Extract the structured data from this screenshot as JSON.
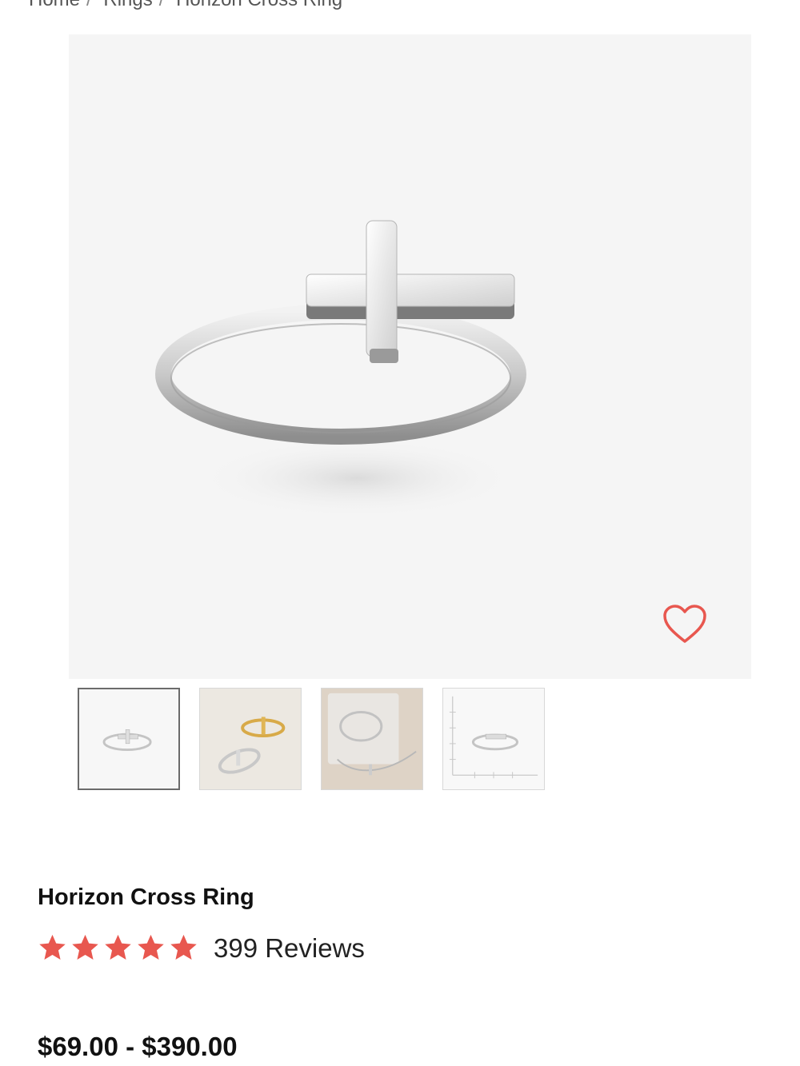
{
  "breadcrumb": {
    "items": [
      "Home",
      "Rings",
      "Horizon Cross Ring"
    ],
    "separator": "/"
  },
  "product": {
    "title": "Horizon Cross Ring",
    "rating_stars": 5,
    "reviews_label": "399 Reviews",
    "price": "$69.00 - $390.00"
  },
  "gallery": {
    "thumbnails": [
      "silver-ring",
      "gold-and-silver-rings",
      "ring-with-necklace",
      "ring-size-chart"
    ],
    "active_index": 0
  },
  "colors": {
    "accent": "#e8574f",
    "hero_background": "#f5f5f5"
  },
  "icons": {
    "favorite": "heart-outline-icon",
    "rating": "star-icon"
  }
}
